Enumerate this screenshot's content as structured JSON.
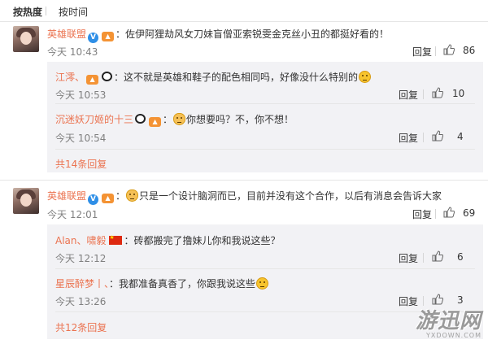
{
  "sort": {
    "hot": "按热度",
    "time": "按时间"
  },
  "actions": {
    "reply_label": "回复"
  },
  "comments": [
    {
      "user": "英雄联盟",
      "sep": "：",
      "text": "佐伊阿狸劫风女刀妹盲僧亚索锐雯金克丝小丑的都挺好看的！",
      "time": "今天 10:43",
      "likes": "86",
      "replies": [
        {
          "user": "江澪、",
          "sep": "：",
          "text": "这不就是英雄和鞋子的配色相同吗，好像没什么特别的",
          "time": "今天 10:53",
          "likes": "10"
        },
        {
          "user": "沉迷妖刀姬的十三",
          "text": "你想要吗？不，你不想！",
          "time": "今天 10:54",
          "likes": "4"
        }
      ],
      "more": "共14条回复"
    },
    {
      "user": "英雄联盟",
      "text": "只是一个设计脑洞而已，目前并没有这个合作，以后有消息会告诉大家",
      "time": "今天 12:01",
      "likes": "69",
      "replies": [
        {
          "user": "Alan、啸毅",
          "sep": "：",
          "text": "砖都搬完了撸妹儿你和我说这些？",
          "time": "今天 12:12",
          "likes": "6"
        },
        {
          "user": "星辰醉梦丨、",
          "sep": "：",
          "text": "我都准备真香了，你跟我说这些",
          "time": "今天 13:26",
          "likes": "3"
        }
      ],
      "more": "共12条回复"
    }
  ],
  "watermark": {
    "brand": "游迅网",
    "domain": "YXDOWN.COM"
  },
  "icons": {
    "verified": "verified-v-icon",
    "like": "thumbs-up-icon"
  },
  "colors": {
    "link": "#eb7350",
    "reply_bg": "#f2f2f5",
    "verified": "#2f8fe7"
  }
}
